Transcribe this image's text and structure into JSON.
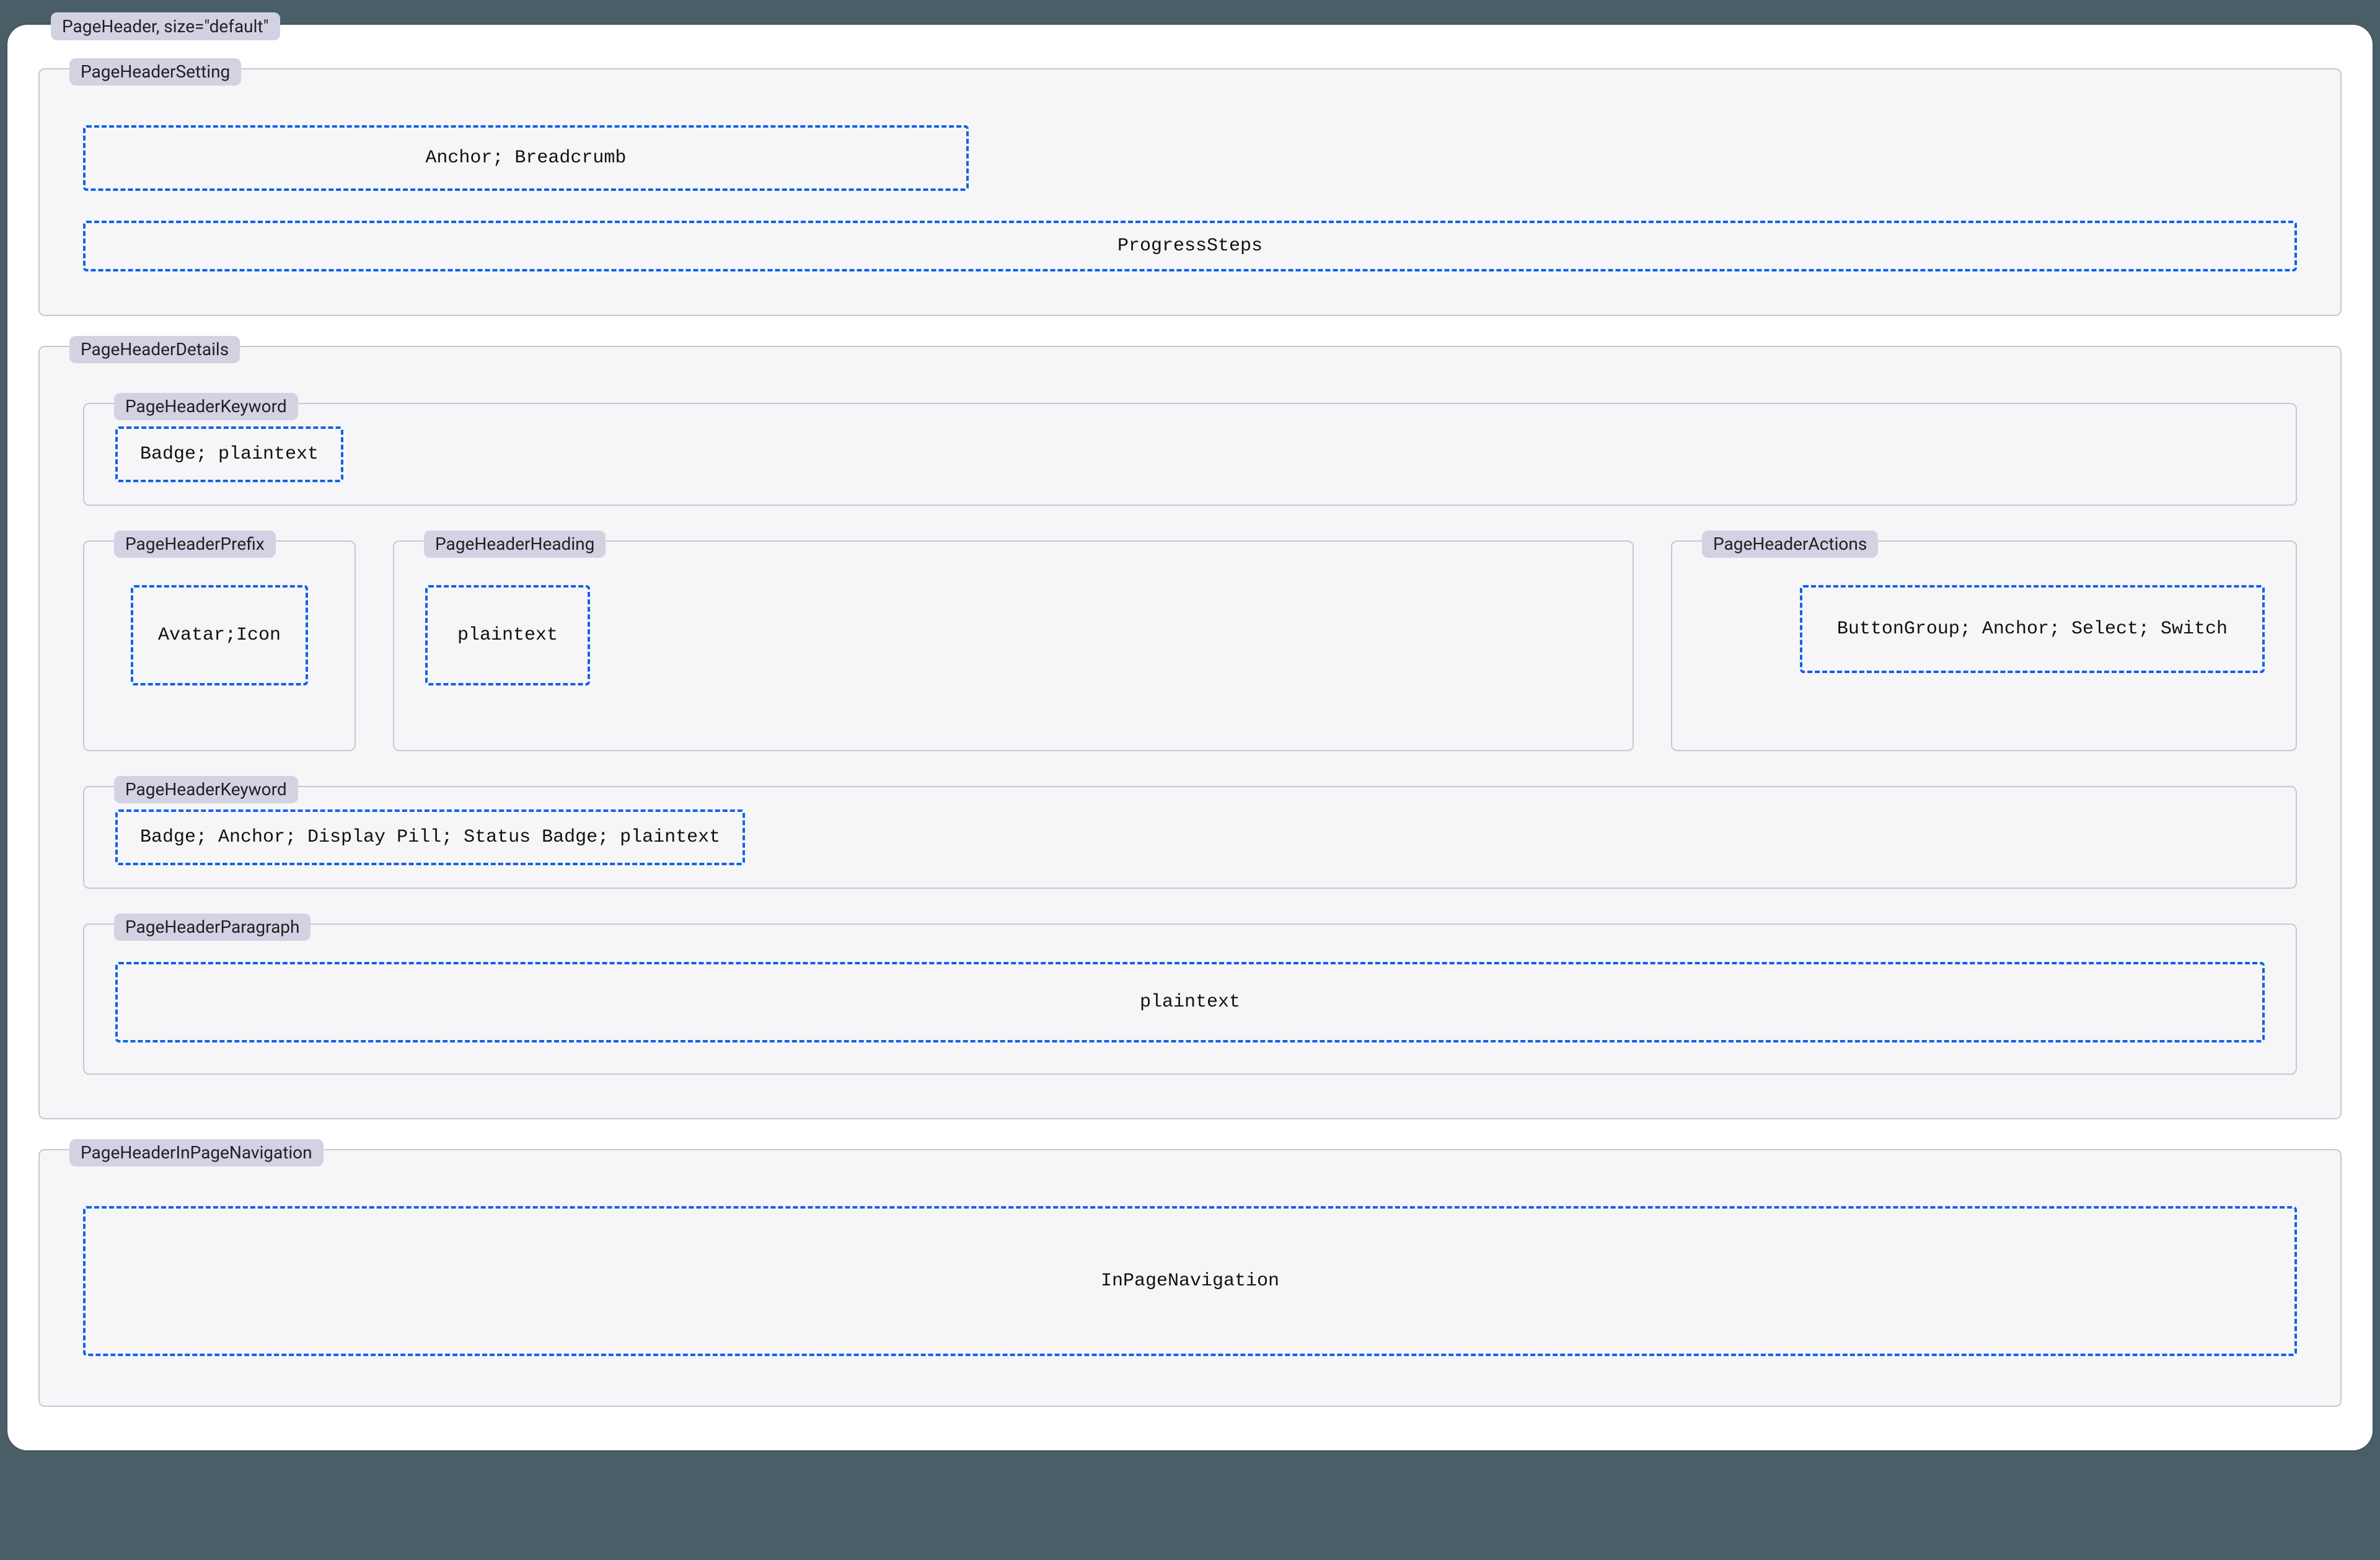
{
  "root": {
    "label": "PageHeader, size=\"default\""
  },
  "setting": {
    "label": "PageHeaderSetting",
    "breadcrumb_slot": "Anchor; Breadcrumb",
    "progress_slot": "ProgressSteps"
  },
  "details": {
    "label": "PageHeaderDetails",
    "keyword_top": {
      "label": "PageHeaderKeyword",
      "slot": "Badge; plaintext"
    },
    "prefix": {
      "label": "PageHeaderPrefix",
      "slot": "Avatar;Icon"
    },
    "heading": {
      "label": "PageHeaderHeading",
      "slot": "plaintext"
    },
    "actions": {
      "label": "PageHeaderActions",
      "slot": "ButtonGroup; Anchor; Select; Switch"
    },
    "keyword_bottom": {
      "label": "PageHeaderKeyword",
      "slot": "Badge; Anchor; Display Pill; Status Badge; plaintext"
    },
    "paragraph": {
      "label": "PageHeaderParagraph",
      "slot": "plaintext"
    }
  },
  "in_page_nav": {
    "label": "PageHeaderInPageNavigation",
    "slot": "InPageNavigation"
  }
}
